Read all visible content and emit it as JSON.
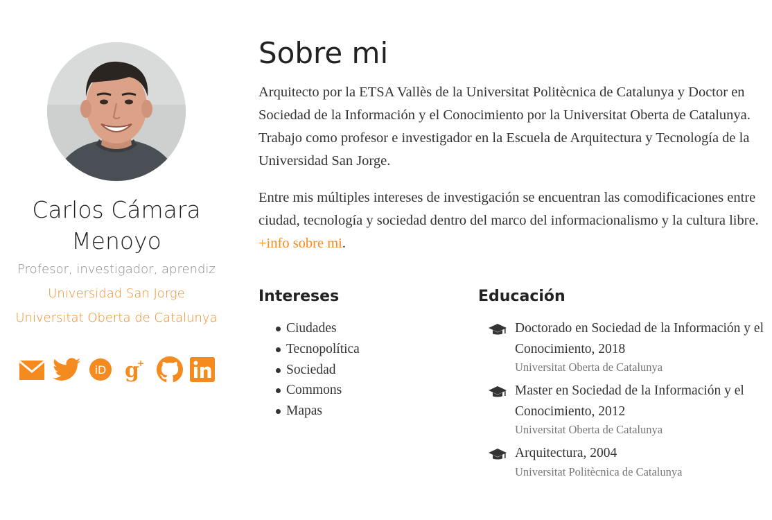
{
  "sidebar": {
    "name_line1": "Carlos Cámara",
    "name_line2": "Menoyo",
    "role": "Profesor, investigador, aprendiz",
    "organizations": [
      "Universidad San Jorge",
      "Universitat Oberta de Catalunya"
    ],
    "social_icons": [
      "envelope-icon",
      "twitter-icon",
      "orcid-icon",
      "google-scholar-icon",
      "github-icon",
      "linkedin-icon"
    ]
  },
  "about": {
    "title": "Sobre mi",
    "paragraph1": "Arquitecto por la ETSA Vallès de la Universitat Politècnica de Catalunya y Doctor en Sociedad de la Información y el Conocimiento por la Universitat Oberta de Catalunya. Trabajo como profesor e investigador en la Escuela de Arquitectura y Tecnología de la Universidad San Jorge.",
    "paragraph2_text": "Entre mis múltiples intereses de investigación se encuentran las comodificaciones entre ciudad, tecnología y sociedad dentro del marco del informacionalismo y la cultura libre. ",
    "paragraph2_link": "+info sobre mi",
    "paragraph2_end": "."
  },
  "interests": {
    "title": "Intereses",
    "items": [
      "Ciudades",
      "Tecnopolítica",
      "Sociedad",
      "Commons",
      "Mapas"
    ]
  },
  "education": {
    "title": "Educación",
    "items": [
      {
        "degree": "Doctorado en Sociedad de la Información y el Conocimiento, 2018",
        "institution": "Universitat Oberta de Catalunya"
      },
      {
        "degree": "Master en Sociedad de la Información y el Conocimiento, 2012",
        "institution": "Universitat Oberta de Catalunya"
      },
      {
        "degree": "Arquitectura, 2004",
        "institution": "Universitat Politècnica de Catalunya"
      }
    ]
  },
  "colors": {
    "accent": "#f58a1f",
    "text": "#333333",
    "muted": "#8a8a8a"
  }
}
